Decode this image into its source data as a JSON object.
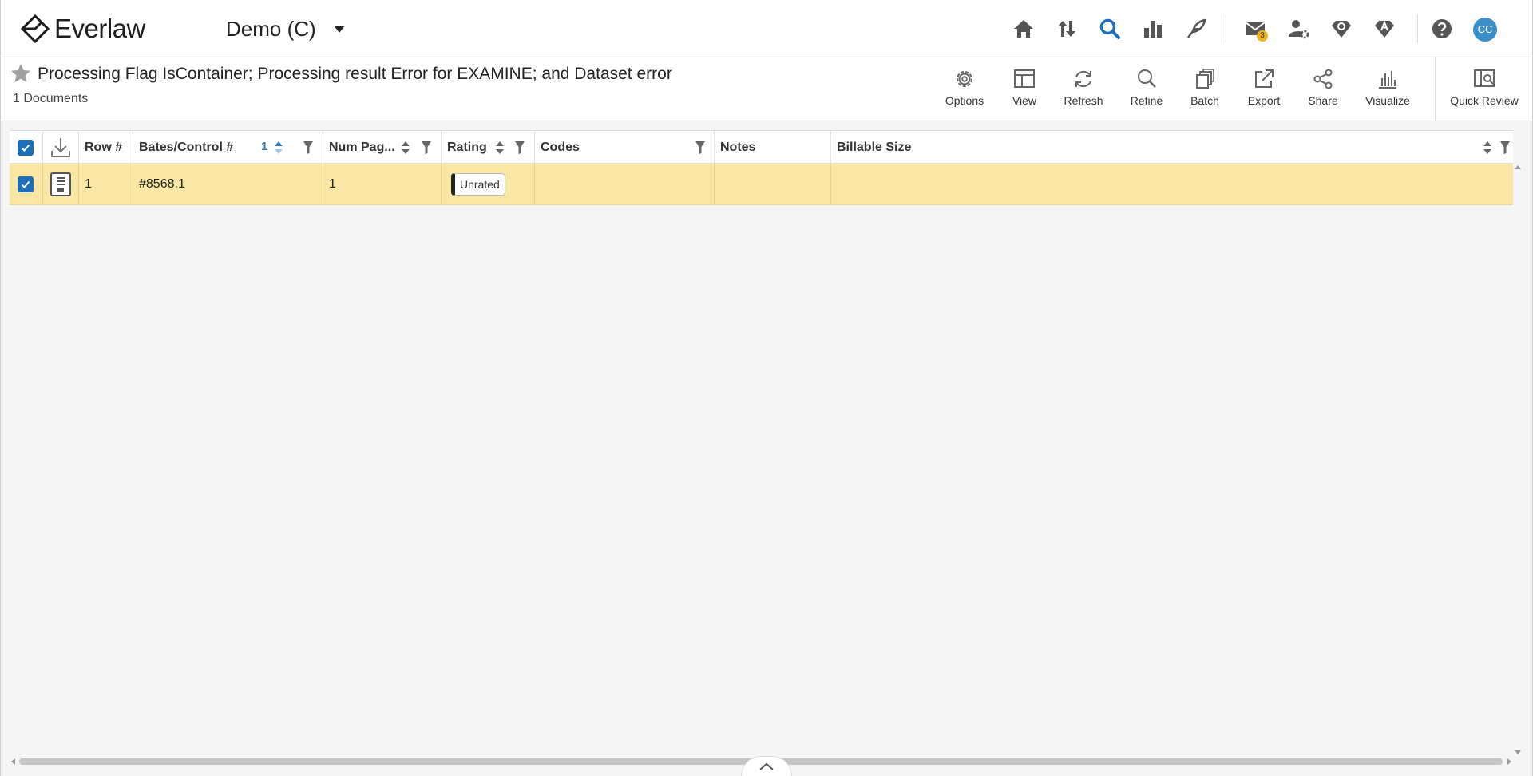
{
  "app": {
    "name": "Everlaw",
    "project": "Demo (C)"
  },
  "nav": {
    "items": [
      {
        "name": "home-icon"
      },
      {
        "name": "review-window-icon"
      },
      {
        "name": "search-icon",
        "active": true
      },
      {
        "name": "analytics-icon"
      },
      {
        "name": "storybuilder-icon"
      },
      {
        "name": "messages-icon",
        "badge": "3"
      },
      {
        "name": "user-admin-icon"
      },
      {
        "name": "project-settings-icon"
      },
      {
        "name": "admin-icon"
      },
      {
        "name": "help-icon"
      }
    ],
    "avatar": "CC"
  },
  "header": {
    "title": "Processing Flag IsContainer; Processing result Error for EXAMINE; and Dataset error",
    "doc_count": "1 Documents"
  },
  "toolbar": {
    "options": "Options",
    "view": "View",
    "refresh": "Refresh",
    "refine": "Refine",
    "batch": "Batch",
    "export": "Export",
    "share": "Share",
    "visualize": "Visualize",
    "quick_review": "Quick Review"
  },
  "table": {
    "columns": {
      "row": "Row #",
      "bates": "Bates/Control #",
      "bates_sort_order": "1",
      "num_pages": "Num Pag...",
      "rating": "Rating",
      "codes": "Codes",
      "notes": "Notes",
      "billable_size": "Billable Size"
    },
    "rows": [
      {
        "row": "1",
        "bates": "#8568.1",
        "num_pages": "1",
        "rating": "Unrated",
        "codes": "",
        "notes": "",
        "billable_size": "",
        "selected": true
      }
    ]
  },
  "colors": {
    "accent": "#1e6fb8",
    "row_selected": "#fae6a5",
    "badge": "#f0b320",
    "avatar": "#3b8fc9"
  }
}
